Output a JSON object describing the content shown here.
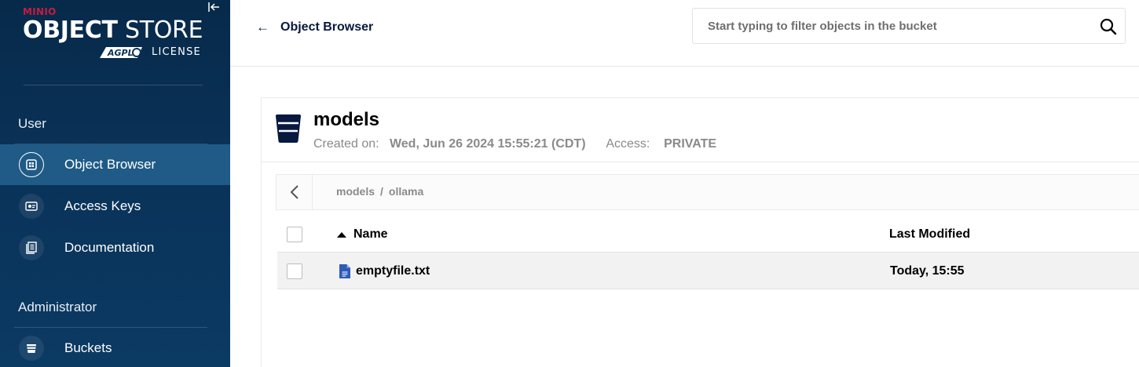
{
  "sidebar": {
    "brand": "MINIO",
    "product_bold": "OBJECT",
    "product_light": "STORE",
    "agpl_text": "AGPL",
    "license": "LICENSE",
    "sections": [
      {
        "label": "User",
        "items": [
          {
            "label": "Object Browser",
            "icon": "object-browser-icon",
            "active": true
          },
          {
            "label": "Access Keys",
            "icon": "access-keys-icon",
            "active": false
          },
          {
            "label": "Documentation",
            "icon": "documentation-icon",
            "active": false
          }
        ]
      },
      {
        "label": "Administrator",
        "items": [
          {
            "label": "Buckets",
            "icon": "buckets-icon",
            "active": false
          }
        ]
      }
    ]
  },
  "header": {
    "back_label": "Object Browser",
    "search_placeholder": "Start typing to filter objects in the bucket"
  },
  "bucket": {
    "name": "models",
    "created_label": "Created on:",
    "created_value": "Wed, Jun 26 2024 15:55:21 (CDT)",
    "access_label": "Access:",
    "access_value": "PRIVATE"
  },
  "breadcrumb": {
    "segments": [
      "models",
      "ollama"
    ],
    "separator": "/"
  },
  "table": {
    "columns": {
      "name": "Name",
      "modified": "Last Modified"
    },
    "rows": [
      {
        "name": "emptyfile.txt",
        "modified": "Today, 15:55",
        "icon": "text-file-icon"
      }
    ]
  },
  "colors": {
    "sidebar_bg": "#0a3258",
    "active_item": "#1f5b86",
    "brand_red": "#c51c3f",
    "heading_navy": "#07193e"
  }
}
